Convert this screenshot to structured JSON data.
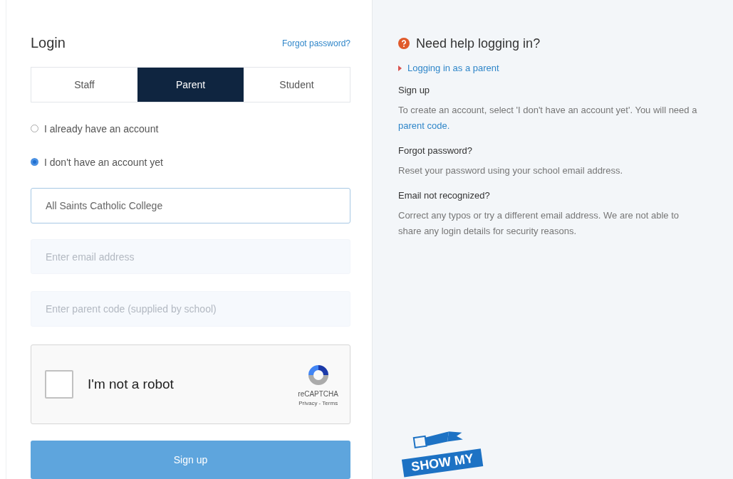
{
  "login": {
    "title": "Login",
    "forgot_link": "Forgot password?",
    "tabs": [
      {
        "label": "Staff",
        "selected": false
      },
      {
        "label": "Parent",
        "selected": true
      },
      {
        "label": "Student",
        "selected": false
      }
    ],
    "options": [
      {
        "label": "I already have an account",
        "selected": false
      },
      {
        "label": "I don't have an account yet",
        "selected": true
      }
    ],
    "school_field": {
      "value": "All Saints Catholic College"
    },
    "email_field": {
      "placeholder": "Enter email address"
    },
    "code_field": {
      "placeholder": "Enter parent code (supplied by school)"
    },
    "captcha": {
      "label": "I'm not a robot",
      "checked": false,
      "brand": "reCAPTCHA",
      "links": "Privacy - Terms"
    },
    "submit": "Sign up"
  },
  "help": {
    "title": "Need help logging in?",
    "link": "Logging in as a parent",
    "sections": [
      {
        "heading": "Sign up",
        "text": "To create an account, select 'I don't have an account yet'. You will need a ",
        "link": "parent code."
      },
      {
        "heading": "Forgot password?",
        "text": "Reset your password using your school email address."
      },
      {
        "heading": "Email not recognized?",
        "text": "Correct any typos or try a different email address. We are not able to share any login details for security reasons."
      }
    ],
    "logo_text": "SHOW MY"
  }
}
